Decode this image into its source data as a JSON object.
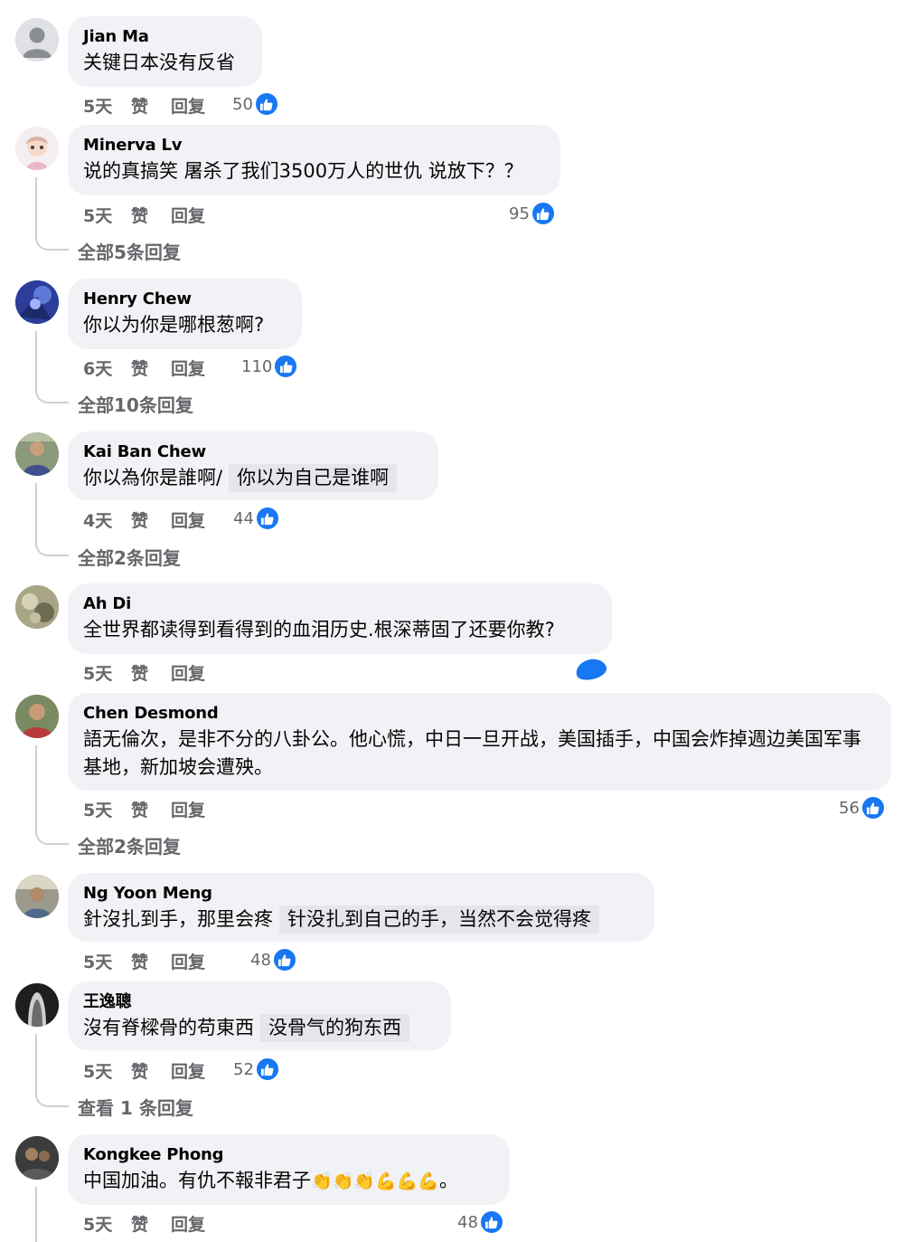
{
  "actions": {
    "like": "赞",
    "reply": "回复"
  },
  "comments": [
    {
      "author": "Jian Ma",
      "text": "关键日本没有反省",
      "time": "5天",
      "reactions": "50",
      "view_replies": ""
    },
    {
      "author": "Minerva Lv",
      "text": "说的真搞笑 屠杀了我们3500万人的世仇 说放下？？",
      "time": "5天",
      "reactions": "95",
      "view_replies": "全部5条回复"
    },
    {
      "author": "Henry Chew",
      "text": "你以为你是哪根葱啊?",
      "time": "6天",
      "reactions": "110",
      "view_replies": "全部10条回复"
    },
    {
      "author": "Kai Ban Chew",
      "text": "你以為你是誰啊/",
      "translation": "你以为自己是谁啊",
      "time": "4天",
      "reactions": "44",
      "view_replies": "全部2条回复"
    },
    {
      "author": "Ah Di",
      "text": "全世界都读得到看得到的血泪历史.根深蒂固了还要你教?",
      "time": "5天",
      "reactions": "",
      "view_replies": ""
    },
    {
      "author": "Chen Desmond",
      "text": "語无倫次，是非不分的八卦公。他心慌，中日一旦开战，美国插手，中国会炸掉週边美国军事基地，新加坡会遭殃。",
      "time": "5天",
      "reactions": "56",
      "view_replies": "全部2条回复"
    },
    {
      "author": "Ng Yoon Meng",
      "text": "針沒扎到手，那里会疼",
      "translation": "针没扎到自己的手，当然不会觉得疼",
      "time": "5天",
      "reactions": "48",
      "view_replies": ""
    },
    {
      "author": "王逸聰",
      "text": "沒有脊樑骨的苟東西",
      "translation": "没骨气的狗东西",
      "time": "5天",
      "reactions": "52",
      "view_replies": "查看 1 条回复"
    },
    {
      "author": "Kongkee Phong",
      "text": "中国加油。有仇不報非君子",
      "emoji_text": "👏👏👏💪💪💪",
      "text_suffix": "。",
      "time": "5天",
      "reactions": "48",
      "view_replies": ""
    }
  ],
  "colors": {
    "bubble": "#f0f2f5",
    "like_blue": "#1877f2",
    "meta_gray": "#65676b"
  },
  "icons": {
    "like": "thumbs-up-icon",
    "avatar_placeholder": "default-avatar-icon"
  }
}
